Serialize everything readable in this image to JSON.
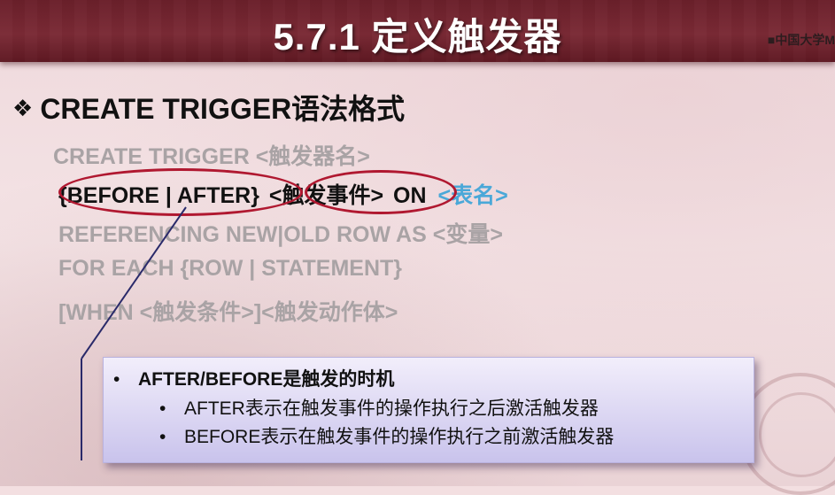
{
  "slide": {
    "title": "5.7.1  定义触发器",
    "watermark": "■中国大学M"
  },
  "heading": {
    "bullet": "❖",
    "text": "CREATE TRIGGER语法格式"
  },
  "syntax": {
    "line1": "CREATE TRIGGER <触发器名>",
    "line2_part1": "{BEFORE | AFTER}",
    "line2_part2": "<触发事件>",
    "line2_part3": "ON",
    "line2_part4": "<表名>",
    "line3": "REFERENCING NEW|OLD ROW AS <变量>",
    "line4": "FOR EACH  {ROW | STATEMENT}",
    "line5": "[WHEN <触发条件>]<触发动作体>"
  },
  "note": {
    "bullet": "•",
    "main": "AFTER/BEFORE是触发的时机",
    "sub_bullet": "•",
    "sub1": "AFTER表示在触发事件的操作执行之后激活触发器",
    "sub2": "BEFORE表示在触发事件的操作执行之前激活触发器"
  },
  "colors": {
    "header": "#6a1f2a",
    "highlight_ellipse": "#b01830",
    "table_name": "#4aa8d8",
    "pointer_line": "#2a2a6a"
  }
}
